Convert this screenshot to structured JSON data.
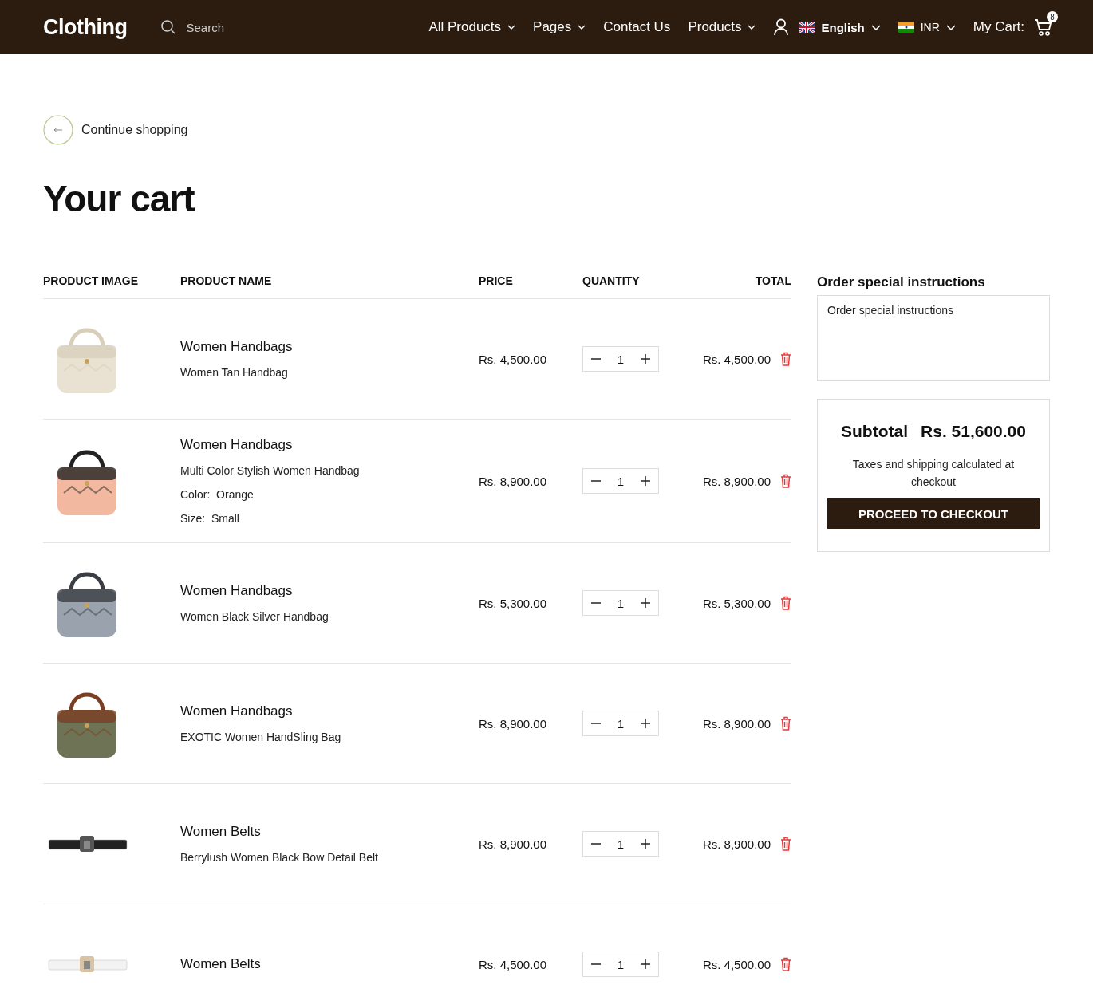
{
  "header": {
    "logo": "Clothing",
    "search": {
      "placeholder": "Search"
    },
    "nav": [
      {
        "label": "All Products",
        "dropdown": true
      },
      {
        "label": "Pages",
        "dropdown": true
      },
      {
        "label": "Contact Us",
        "dropdown": false
      },
      {
        "label": "Products",
        "dropdown": true
      }
    ],
    "language": "English",
    "currency": "INR",
    "cart_label": "My Cart:",
    "cart_count": "8"
  },
  "back_link": "Continue shopping",
  "title": "Your cart",
  "table": {
    "columns": [
      "PRODUCT IMAGE",
      "PRODUCT NAME",
      "PRICE",
      "QUANTITY",
      "TOTAL"
    ],
    "rows": [
      {
        "kind": "round-bag",
        "category": "Women Handbags",
        "name": "Women Tan Handbag",
        "options": [],
        "price": "Rs. 4,500.00",
        "quantity": "1",
        "total": "Rs. 4,500.00"
      },
      {
        "kind": "zigzag-bag",
        "category": "Women Handbags",
        "name": "Multi Color Stylish Women Handbag",
        "options": [
          {
            "label": "Color:",
            "value": "Orange"
          },
          {
            "label": "Size:",
            "value": "Small"
          }
        ],
        "price": "Rs. 8,900.00",
        "quantity": "1",
        "total": "Rs. 8,900.00"
      },
      {
        "kind": "striped-bag",
        "category": "Women Handbags",
        "name": "Women Black Silver Handbag",
        "options": [],
        "price": "Rs. 5,300.00",
        "quantity": "1",
        "total": "Rs. 5,300.00"
      },
      {
        "kind": "olive-bag",
        "category": "Women Handbags",
        "name": "EXOTIC Women HandSling Bag",
        "options": [],
        "price": "Rs. 8,900.00",
        "quantity": "1",
        "total": "Rs. 8,900.00"
      },
      {
        "kind": "black-belt",
        "category": "Women Belts",
        "name": "Berrylush Women Black Bow Detail Belt",
        "options": [],
        "price": "Rs. 8,900.00",
        "quantity": "1",
        "total": "Rs. 8,900.00"
      },
      {
        "kind": "white-belt",
        "category": "Women Belts",
        "options": [],
        "price": "Rs. 4,500.00",
        "quantity": "1",
        "total": "Rs. 4,500.00"
      }
    ]
  },
  "instructions": {
    "heading": "Order special instructions",
    "placeholder": "Order special instructions"
  },
  "summary": {
    "label": "Subtotal",
    "amount": "Rs. 51,600.00",
    "note": "Taxes and shipping calculated at checkout",
    "button": "PROCEED TO CHECKOUT"
  }
}
